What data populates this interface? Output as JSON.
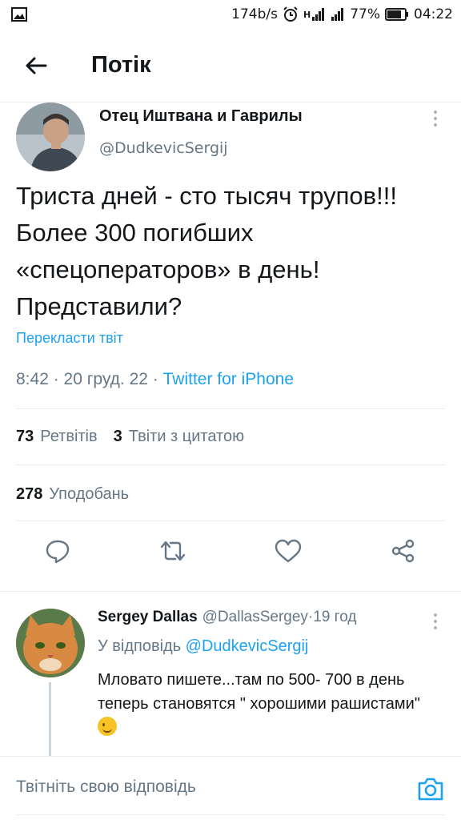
{
  "status_bar": {
    "speed": "174b/s",
    "battery_percent": "77%",
    "time": "04:22",
    "network_label": "H"
  },
  "header": {
    "title": "Потік"
  },
  "tweet": {
    "author_name": "Отец Иштвана и Гаврилы",
    "author_handle": "@DudkevicSergij",
    "text": "Триста дней - сто тысяч трупов!!! Более 300 погибших «спецоператоров» в день! Представили?",
    "translate_label": "Перекласти твіт",
    "time": "8:42",
    "separator": " · ",
    "date": "20 груд. 22",
    "source": "Twitter for iPhone",
    "retweets_count": "73",
    "retweets_label": "Ретвітів",
    "quotes_count": "3",
    "quotes_label": "Твіти з цитатою",
    "likes_count": "278",
    "likes_label": "Уподобань"
  },
  "reply": {
    "author_name": "Sergey Dallas",
    "author_handle": "@DallasSergey",
    "separator": " · ",
    "time": "19 год",
    "reply_to_prefix": "У відповідь ",
    "reply_to_handle": "@DudkevicSergij",
    "text": "Мловато пишете...там по 500- 700 в день теперь становятся \" хорошими рашистами\""
  },
  "compose": {
    "placeholder": "Твітніть свою відповідь"
  },
  "colors": {
    "accent": "#1da1f2",
    "secondary_text": "#657786",
    "divider": "#e6ecf0",
    "icon": "#657786"
  }
}
